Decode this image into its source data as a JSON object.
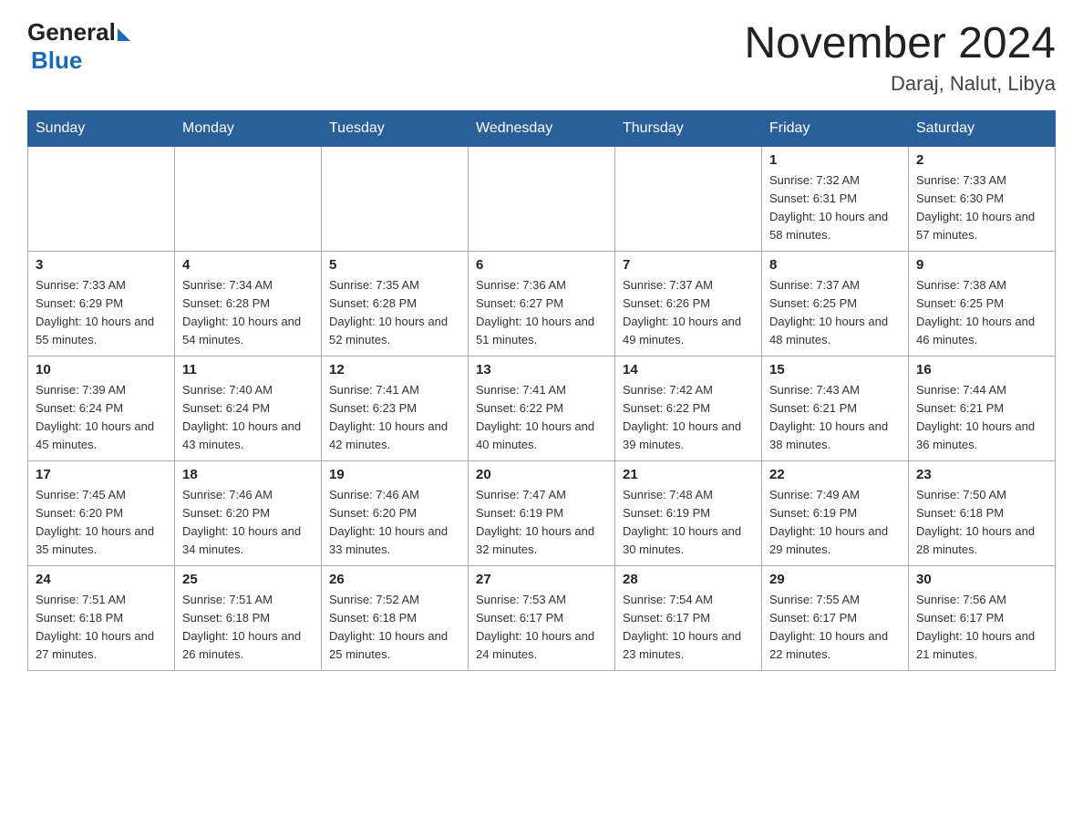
{
  "header": {
    "logo_general": "General",
    "logo_blue": "Blue",
    "month_title": "November 2024",
    "location": "Daraj, Nalut, Libya"
  },
  "weekdays": [
    "Sunday",
    "Monday",
    "Tuesday",
    "Wednesday",
    "Thursday",
    "Friday",
    "Saturday"
  ],
  "weeks": [
    [
      {
        "day": "",
        "sunrise": "",
        "sunset": "",
        "daylight": ""
      },
      {
        "day": "",
        "sunrise": "",
        "sunset": "",
        "daylight": ""
      },
      {
        "day": "",
        "sunrise": "",
        "sunset": "",
        "daylight": ""
      },
      {
        "day": "",
        "sunrise": "",
        "sunset": "",
        "daylight": ""
      },
      {
        "day": "",
        "sunrise": "",
        "sunset": "",
        "daylight": ""
      },
      {
        "day": "1",
        "sunrise": "Sunrise: 7:32 AM",
        "sunset": "Sunset: 6:31 PM",
        "daylight": "Daylight: 10 hours and 58 minutes."
      },
      {
        "day": "2",
        "sunrise": "Sunrise: 7:33 AM",
        "sunset": "Sunset: 6:30 PM",
        "daylight": "Daylight: 10 hours and 57 minutes."
      }
    ],
    [
      {
        "day": "3",
        "sunrise": "Sunrise: 7:33 AM",
        "sunset": "Sunset: 6:29 PM",
        "daylight": "Daylight: 10 hours and 55 minutes."
      },
      {
        "day": "4",
        "sunrise": "Sunrise: 7:34 AM",
        "sunset": "Sunset: 6:28 PM",
        "daylight": "Daylight: 10 hours and 54 minutes."
      },
      {
        "day": "5",
        "sunrise": "Sunrise: 7:35 AM",
        "sunset": "Sunset: 6:28 PM",
        "daylight": "Daylight: 10 hours and 52 minutes."
      },
      {
        "day": "6",
        "sunrise": "Sunrise: 7:36 AM",
        "sunset": "Sunset: 6:27 PM",
        "daylight": "Daylight: 10 hours and 51 minutes."
      },
      {
        "day": "7",
        "sunrise": "Sunrise: 7:37 AM",
        "sunset": "Sunset: 6:26 PM",
        "daylight": "Daylight: 10 hours and 49 minutes."
      },
      {
        "day": "8",
        "sunrise": "Sunrise: 7:37 AM",
        "sunset": "Sunset: 6:25 PM",
        "daylight": "Daylight: 10 hours and 48 minutes."
      },
      {
        "day": "9",
        "sunrise": "Sunrise: 7:38 AM",
        "sunset": "Sunset: 6:25 PM",
        "daylight": "Daylight: 10 hours and 46 minutes."
      }
    ],
    [
      {
        "day": "10",
        "sunrise": "Sunrise: 7:39 AM",
        "sunset": "Sunset: 6:24 PM",
        "daylight": "Daylight: 10 hours and 45 minutes."
      },
      {
        "day": "11",
        "sunrise": "Sunrise: 7:40 AM",
        "sunset": "Sunset: 6:24 PM",
        "daylight": "Daylight: 10 hours and 43 minutes."
      },
      {
        "day": "12",
        "sunrise": "Sunrise: 7:41 AM",
        "sunset": "Sunset: 6:23 PM",
        "daylight": "Daylight: 10 hours and 42 minutes."
      },
      {
        "day": "13",
        "sunrise": "Sunrise: 7:41 AM",
        "sunset": "Sunset: 6:22 PM",
        "daylight": "Daylight: 10 hours and 40 minutes."
      },
      {
        "day": "14",
        "sunrise": "Sunrise: 7:42 AM",
        "sunset": "Sunset: 6:22 PM",
        "daylight": "Daylight: 10 hours and 39 minutes."
      },
      {
        "day": "15",
        "sunrise": "Sunrise: 7:43 AM",
        "sunset": "Sunset: 6:21 PM",
        "daylight": "Daylight: 10 hours and 38 minutes."
      },
      {
        "day": "16",
        "sunrise": "Sunrise: 7:44 AM",
        "sunset": "Sunset: 6:21 PM",
        "daylight": "Daylight: 10 hours and 36 minutes."
      }
    ],
    [
      {
        "day": "17",
        "sunrise": "Sunrise: 7:45 AM",
        "sunset": "Sunset: 6:20 PM",
        "daylight": "Daylight: 10 hours and 35 minutes."
      },
      {
        "day": "18",
        "sunrise": "Sunrise: 7:46 AM",
        "sunset": "Sunset: 6:20 PM",
        "daylight": "Daylight: 10 hours and 34 minutes."
      },
      {
        "day": "19",
        "sunrise": "Sunrise: 7:46 AM",
        "sunset": "Sunset: 6:20 PM",
        "daylight": "Daylight: 10 hours and 33 minutes."
      },
      {
        "day": "20",
        "sunrise": "Sunrise: 7:47 AM",
        "sunset": "Sunset: 6:19 PM",
        "daylight": "Daylight: 10 hours and 32 minutes."
      },
      {
        "day": "21",
        "sunrise": "Sunrise: 7:48 AM",
        "sunset": "Sunset: 6:19 PM",
        "daylight": "Daylight: 10 hours and 30 minutes."
      },
      {
        "day": "22",
        "sunrise": "Sunrise: 7:49 AM",
        "sunset": "Sunset: 6:19 PM",
        "daylight": "Daylight: 10 hours and 29 minutes."
      },
      {
        "day": "23",
        "sunrise": "Sunrise: 7:50 AM",
        "sunset": "Sunset: 6:18 PM",
        "daylight": "Daylight: 10 hours and 28 minutes."
      }
    ],
    [
      {
        "day": "24",
        "sunrise": "Sunrise: 7:51 AM",
        "sunset": "Sunset: 6:18 PM",
        "daylight": "Daylight: 10 hours and 27 minutes."
      },
      {
        "day": "25",
        "sunrise": "Sunrise: 7:51 AM",
        "sunset": "Sunset: 6:18 PM",
        "daylight": "Daylight: 10 hours and 26 minutes."
      },
      {
        "day": "26",
        "sunrise": "Sunrise: 7:52 AM",
        "sunset": "Sunset: 6:18 PM",
        "daylight": "Daylight: 10 hours and 25 minutes."
      },
      {
        "day": "27",
        "sunrise": "Sunrise: 7:53 AM",
        "sunset": "Sunset: 6:17 PM",
        "daylight": "Daylight: 10 hours and 24 minutes."
      },
      {
        "day": "28",
        "sunrise": "Sunrise: 7:54 AM",
        "sunset": "Sunset: 6:17 PM",
        "daylight": "Daylight: 10 hours and 23 minutes."
      },
      {
        "day": "29",
        "sunrise": "Sunrise: 7:55 AM",
        "sunset": "Sunset: 6:17 PM",
        "daylight": "Daylight: 10 hours and 22 minutes."
      },
      {
        "day": "30",
        "sunrise": "Sunrise: 7:56 AM",
        "sunset": "Sunset: 6:17 PM",
        "daylight": "Daylight: 10 hours and 21 minutes."
      }
    ]
  ]
}
